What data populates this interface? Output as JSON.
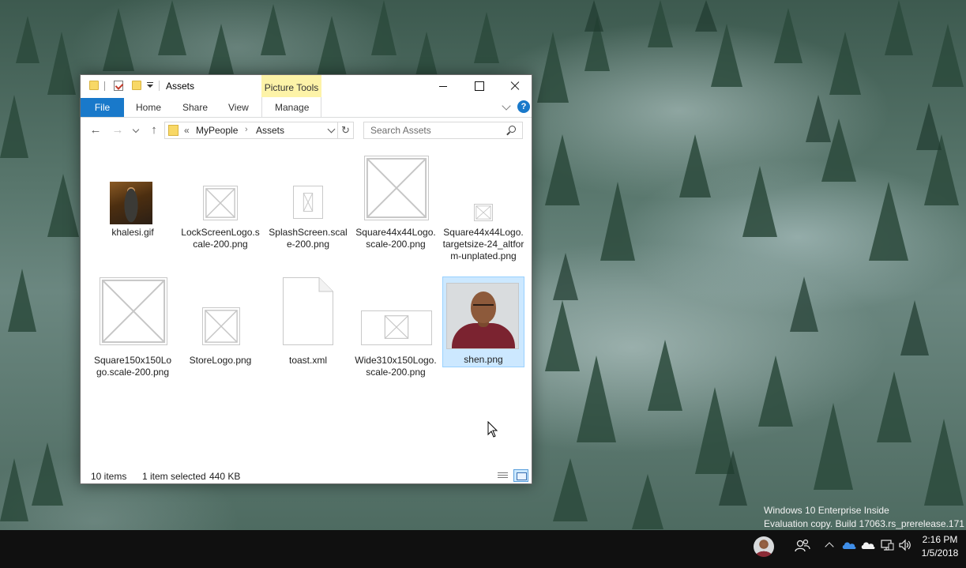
{
  "window": {
    "title": "Assets",
    "contextual_tab": "Picture Tools",
    "controls": {
      "minimize": "minimize",
      "maximize": "maximize",
      "close": "close"
    }
  },
  "ribbon": {
    "file_tab": "File",
    "tabs": [
      "Home",
      "Share",
      "View",
      "Manage"
    ],
    "help": "?"
  },
  "address_bar": {
    "overflow": "«",
    "crumbs": [
      "MyPeople",
      "Assets"
    ],
    "separator": "›"
  },
  "search": {
    "placeholder": "Search Assets"
  },
  "files": [
    {
      "name": "khalesi.gif",
      "kind": "photo"
    },
    {
      "name": "LockScreenLogo.scale-200.png",
      "kind": "placeholder"
    },
    {
      "name": "SplashScreen.scale-200.png",
      "kind": "placeholder"
    },
    {
      "name": "Square44x44Logo.scale-200.png",
      "kind": "placeholder"
    },
    {
      "name": "Square44x44Logo.targetsize-24_altform-unplated.png",
      "kind": "placeholder"
    },
    {
      "name": "Square150x150Logo.scale-200.png",
      "kind": "placeholder"
    },
    {
      "name": "StoreLogo.png",
      "kind": "placeholder"
    },
    {
      "name": "toast.xml",
      "kind": "document"
    },
    {
      "name": "Wide310x150Logo.scale-200.png",
      "kind": "placeholder"
    },
    {
      "name": "shen.png",
      "kind": "photo",
      "selected": true
    }
  ],
  "status": {
    "item_count": "10 items",
    "selection": "1 item selected",
    "size": "440 KB"
  },
  "watermark": {
    "line1": "Windows 10 Enterprise Inside",
    "line2": "Evaluation copy. Build 17063.rs_prerelease.171"
  },
  "taskbar": {
    "time": "2:16 PM",
    "date": "1/5/2018",
    "tray_icons": [
      "avatar",
      "people-icon",
      "show-hidden-icons",
      "onedrive-icon",
      "onedrive-personal-icon",
      "network-icon",
      "volume-icon"
    ]
  },
  "colors": {
    "accent": "#1979ca",
    "contextual_tab": "#fdf3a8",
    "selection": "#cce8ff",
    "taskbar": "#101010"
  }
}
